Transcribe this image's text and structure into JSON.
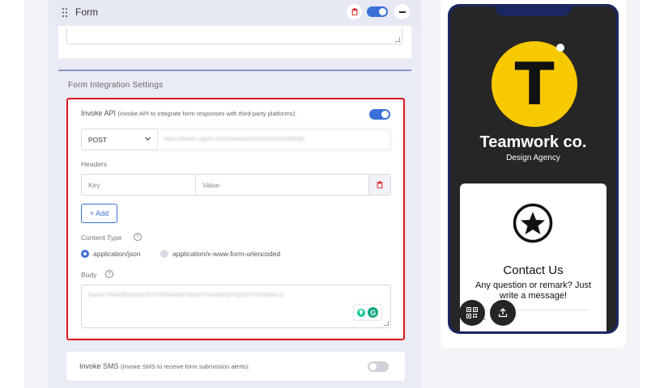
{
  "form_section": {
    "title": "Form"
  },
  "integration": {
    "title": "Form Integration Settings",
    "api": {
      "label": "Invoke API",
      "sublabel": "(Invoke API to integrate form responses with third-party platforms):",
      "method": "POST",
      "url_value": "https://hooks.zapier.com/hooks/catch/15329335/38fpd6/",
      "headers_label": "Headers",
      "key_placeholder": "Key",
      "value_placeholder": "Value",
      "add_label": "+ Add",
      "content_type_label": "Content Type",
      "content_types": [
        "application/json",
        "application/x-www-form-urlencoded"
      ],
      "selected_content_type": "application/json",
      "body_label": "Body",
      "body_value": "Name=%NAME@%QUESTIONNAME%Mail=%NAME@%QUESTIONMAIL%"
    },
    "sms": {
      "label": "Invoke SMS",
      "sublabel": "(Invoke SMS to receive form submission alerts):"
    }
  },
  "preview": {
    "logo_letter": "T",
    "company_name": "Teamwork co.",
    "tagline": "Design Agency",
    "contact_title": "Contact Us",
    "contact_subtitle": "Any question or remark? Just write a message!",
    "name_field_partial": "e *"
  },
  "icons": {
    "drag": "drag-handle-icon",
    "trash": "trash-icon",
    "minus": "minus-icon",
    "chevron": "chevron-down-icon",
    "help": "help-circle-icon",
    "star": "star-circle-icon",
    "qr": "qr-code-icon",
    "share": "share-upload-icon",
    "grammarly": "grammarly-icon"
  },
  "colors": {
    "accent": "#3b6fd8",
    "danger": "#d9151c",
    "logo_yellow": "#f7c900",
    "phone_frame": "#1a2760"
  }
}
